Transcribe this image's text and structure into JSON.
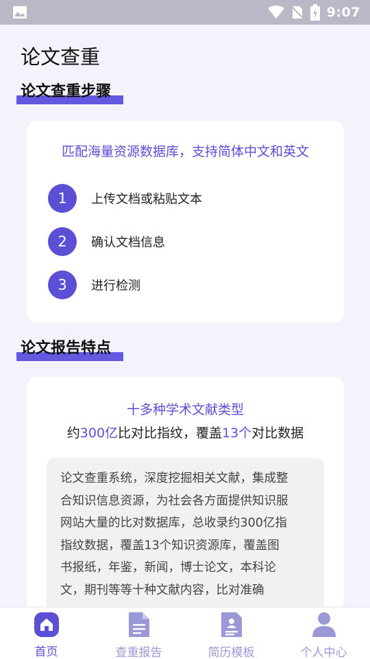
{
  "status_bar": {
    "time": "9:07"
  },
  "page_title": "论文查重",
  "steps_section": {
    "heading": "论文查重步骤",
    "subtitle": "匹配海量资源数据库，支持简体中文和英文",
    "steps": [
      {
        "number": "1",
        "label": "上传文档或粘贴文本"
      },
      {
        "number": "2",
        "label": "确认文档信息"
      },
      {
        "number": "3",
        "label": "进行检测"
      }
    ]
  },
  "report_section": {
    "heading": "论文报告特点",
    "subtitle": "十多种学术文献类型",
    "stats": {
      "prefix": "约",
      "count": "300亿",
      "middle": "比对比指纹，覆盖",
      "sources": "13个",
      "suffix": "对比数据"
    },
    "description_lines": [
      "论文查重系统，深度挖掘相关文献，集成整",
      "合知识信息资源，为社会各方面提供知识服",
      "网站大量的比对数据库，总收录约300亿指",
      "指纹数据，覆盖13个知识资源库，覆盖图",
      "书报纸，年鉴，新闻，博士论文，本科论",
      "文，期刊等等十种文献内容，比对准确"
    ]
  },
  "tabs": [
    {
      "label": "首页",
      "icon": "home-icon",
      "active": true
    },
    {
      "label": "查重报告",
      "icon": "report-icon",
      "active": false
    },
    {
      "label": "简历模板",
      "icon": "resume-icon",
      "active": false
    },
    {
      "label": "个人中心",
      "icon": "user-icon",
      "active": false
    }
  ],
  "colors": {
    "accent": "#5b4fd6",
    "accent_light": "#9a98d6",
    "background": "#f3f3fb",
    "status_bar": "#b8b8c7"
  }
}
